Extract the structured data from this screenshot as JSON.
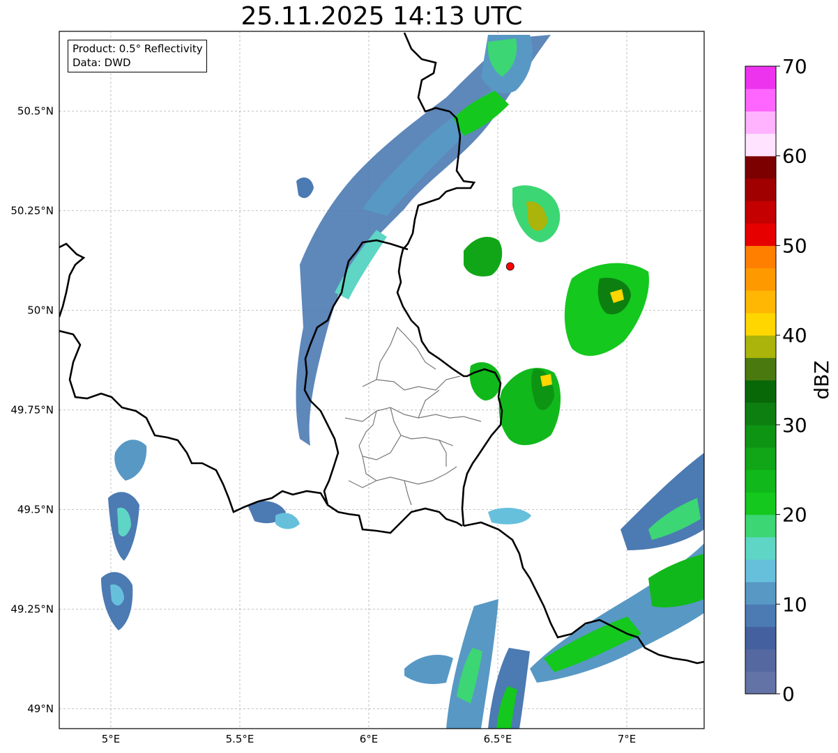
{
  "title": "25.11.2025 14:13 UTC",
  "info": {
    "product": "Product: 0.5° Reflectivity",
    "data": "Data: DWD"
  },
  "map": {
    "lon_range": [
      4.8,
      7.3
    ],
    "lat_range": [
      48.95,
      50.7
    ],
    "gridlines": true,
    "lon_ticks": [
      {
        "value": 5.0,
        "label": "5°E"
      },
      {
        "value": 5.5,
        "label": "5.5°E"
      },
      {
        "value": 6.0,
        "label": "6°E"
      },
      {
        "value": 6.5,
        "label": "6.5°E"
      },
      {
        "value": 7.0,
        "label": "7°E"
      }
    ],
    "lat_ticks": [
      {
        "value": 49.0,
        "label": "49°N"
      },
      {
        "value": 49.25,
        "label": "49.25°N"
      },
      {
        "value": 49.5,
        "label": "49.5°N"
      },
      {
        "value": 49.75,
        "label": "49.75°N"
      },
      {
        "value": 50.0,
        "label": "50°N"
      },
      {
        "value": 50.25,
        "label": "50.25°N"
      },
      {
        "value": 50.5,
        "label": "50.5°N"
      }
    ],
    "radar_site": {
      "lon": 6.548,
      "lat": 50.11,
      "color": "#ff0000"
    }
  },
  "colorbar": {
    "label": "dBZ",
    "min": 0,
    "max": 70,
    "step": 2.5,
    "tick_values": [
      0,
      10,
      20,
      30,
      40,
      50,
      60,
      70
    ],
    "tick_labels": [
      "0",
      "10",
      "20",
      "30",
      "40",
      "50",
      "60",
      "70"
    ],
    "colors": [
      "#6473a6",
      "#5569a0",
      "#44609f",
      "#4c7ab2",
      "#5898c4",
      "#66c0dc",
      "#5ed5c5",
      "#3cd674",
      "#14c81e",
      "#11b81b",
      "#11a617",
      "#0e9413",
      "#0d7f11",
      "#086808",
      "#4a7a0f",
      "#aab40b",
      "#ffd600",
      "#ffb703",
      "#ff9900",
      "#ff7f00",
      "#e60000",
      "#c40000",
      "#a00000",
      "#7d0000",
      "#ffe3ff",
      "#ffb3ff",
      "#ff66ff",
      "#ee33ee"
    ]
  },
  "chart_data": {
    "type": "heatmap",
    "title": "25.11.2025 14:13 UTC",
    "xlabel": "",
    "ylabel": "",
    "colorbar_label": "dBZ",
    "value_range": [
      0,
      70
    ],
    "xlim": [
      4.8,
      7.3
    ],
    "ylim": [
      48.95,
      50.7
    ],
    "cells": [
      {
        "lon": 5.05,
        "lat": 49.65,
        "dbz": 12
      },
      {
        "lon": 5.05,
        "lat": 49.45,
        "dbz": 14
      },
      {
        "lon": 5.05,
        "lat": 49.3,
        "dbz": 13
      },
      {
        "lon": 5.9,
        "lat": 50.05,
        "dbz": 10
      },
      {
        "lon": 6.05,
        "lat": 50.35,
        "dbz": 12
      },
      {
        "lon": 6.3,
        "lat": 50.55,
        "dbz": 16
      },
      {
        "lon": 6.5,
        "lat": 50.55,
        "dbz": 22
      },
      {
        "lon": 6.5,
        "lat": 50.12,
        "dbz": 24
      },
      {
        "lon": 6.65,
        "lat": 50.27,
        "dbz": 30
      },
      {
        "lon": 6.98,
        "lat": 50.03,
        "dbz": 32
      },
      {
        "lon": 6.68,
        "lat": 49.8,
        "dbz": 28
      },
      {
        "lon": 6.45,
        "lat": 49.82,
        "dbz": 24
      },
      {
        "lon": 7.2,
        "lat": 49.35,
        "dbz": 26
      },
      {
        "lon": 6.9,
        "lat": 49.15,
        "dbz": 24
      },
      {
        "lon": 6.5,
        "lat": 49.0,
        "dbz": 18
      },
      {
        "lon": 6.35,
        "lat": 49.1,
        "dbz": 18
      }
    ]
  }
}
